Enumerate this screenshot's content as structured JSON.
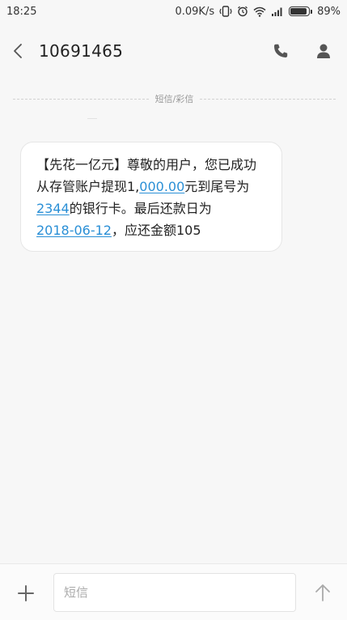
{
  "status_bar": {
    "time": "18:25",
    "net_speed": "0.09K/s",
    "battery_percent": "89%",
    "battery_level": 0.89
  },
  "header": {
    "sender_number": "10691465"
  },
  "thread": {
    "message_type_label": "短信/彩信",
    "message": {
      "part1": "【先花一亿元】尊敬的用户，您已成功从存管账户提现1,",
      "amount": "000.00",
      "part2": "元到尾号为",
      "card_tail": "2344",
      "part3": "的银行卡。最后还款日为",
      "due_date": "2018-06-12",
      "part4": "，应还金额105"
    }
  },
  "composer": {
    "placeholder": "短信"
  },
  "colors": {
    "link": "#2a8fd6",
    "background": "#f7f7f7",
    "bubble": "#ffffff"
  }
}
